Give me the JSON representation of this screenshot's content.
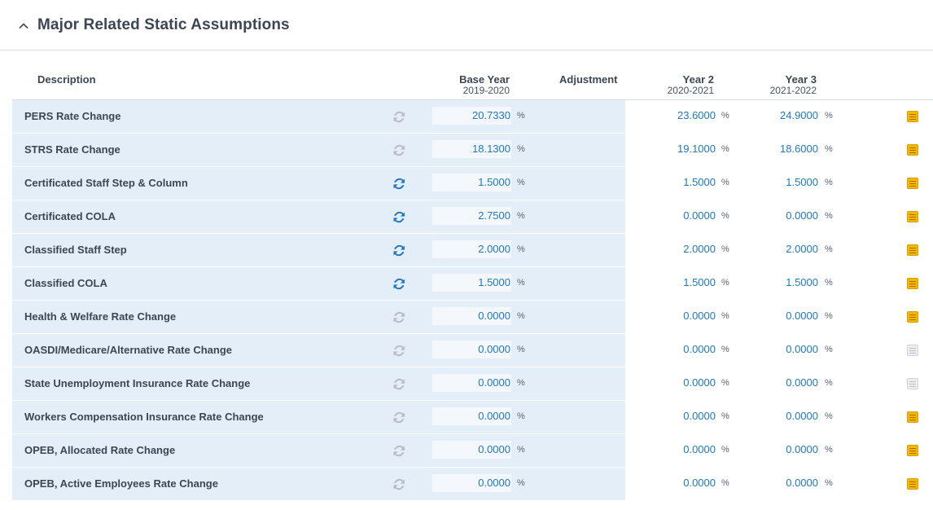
{
  "section": {
    "title": "Major Related Static Assumptions",
    "toggle_icon": "chevron-up-icon"
  },
  "columns": {
    "description": "Description",
    "base_year": {
      "label": "Base Year",
      "period": "2019-2020"
    },
    "adjustment": "Adjustment",
    "year2": {
      "label": "Year 2",
      "period": "2020-2021"
    },
    "year3": {
      "label": "Year 3",
      "period": "2021-2022"
    }
  },
  "unit": "%",
  "colors": {
    "value_blue": "#1f78be",
    "refresh_active": "#1f78be",
    "refresh_inactive": "#b5bcc4",
    "note_active": "#f5b800",
    "note_inactive": "#eceef1",
    "row_band": "#e3eef8"
  },
  "rows": [
    {
      "description": "PERS Rate Change",
      "refresh_active": false,
      "base": "20.7330",
      "year2": "23.6000",
      "year3": "24.9000",
      "note_active": true
    },
    {
      "description": "STRS Rate Change",
      "refresh_active": false,
      "base": "18.1300",
      "year2": "19.1000",
      "year3": "18.6000",
      "note_active": true
    },
    {
      "description": "Certificated Staff Step & Column",
      "refresh_active": true,
      "base": "1.5000",
      "year2": "1.5000",
      "year3": "1.5000",
      "note_active": true
    },
    {
      "description": "Certificated COLA",
      "refresh_active": true,
      "base": "2.7500",
      "year2": "0.0000",
      "year3": "0.0000",
      "note_active": true
    },
    {
      "description": "Classified Staff Step",
      "refresh_active": true,
      "base": "2.0000",
      "year2": "2.0000",
      "year3": "2.0000",
      "note_active": true
    },
    {
      "description": "Classified COLA",
      "refresh_active": true,
      "base": "1.5000",
      "year2": "1.5000",
      "year3": "1.5000",
      "note_active": true
    },
    {
      "description": "Health & Welfare Rate Change",
      "refresh_active": false,
      "base": "0.0000",
      "year2": "0.0000",
      "year3": "0.0000",
      "note_active": true
    },
    {
      "description": "OASDI/Medicare/Alternative Rate Change",
      "refresh_active": false,
      "base": "0.0000",
      "year2": "0.0000",
      "year3": "0.0000",
      "note_active": false
    },
    {
      "description": "State Unemployment Insurance Rate Change",
      "refresh_active": false,
      "base": "0.0000",
      "year2": "0.0000",
      "year3": "0.0000",
      "note_active": false
    },
    {
      "description": "Workers Compensation Insurance Rate Change",
      "refresh_active": false,
      "base": "0.0000",
      "year2": "0.0000",
      "year3": "0.0000",
      "note_active": true
    },
    {
      "description": "OPEB, Allocated Rate Change",
      "refresh_active": false,
      "base": "0.0000",
      "year2": "0.0000",
      "year3": "0.0000",
      "note_active": true
    },
    {
      "description": "OPEB, Active Employees Rate Change",
      "refresh_active": false,
      "base": "0.0000",
      "year2": "0.0000",
      "year3": "0.0000",
      "note_active": true
    }
  ]
}
